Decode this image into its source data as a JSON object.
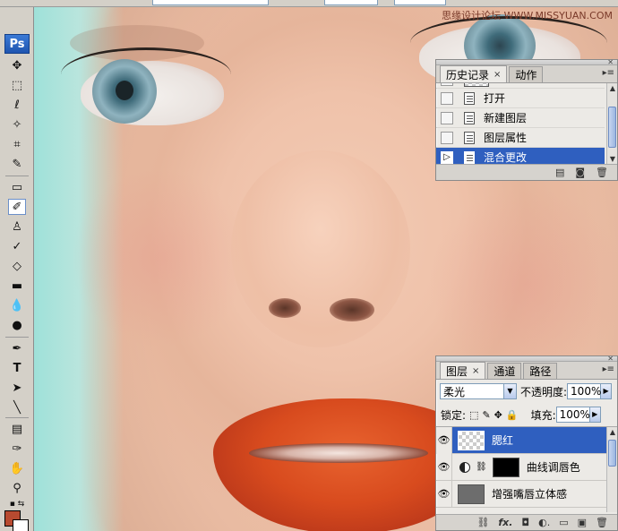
{
  "watermark": "思缘设计论坛  WWW.MISSYUAN.COM",
  "toolbox": {
    "logo": "Ps",
    "colors": {
      "foreground": "#b84a30",
      "background": "#ffffff"
    }
  },
  "history_panel": {
    "tabs": [
      {
        "label": "历史记录",
        "active": true
      },
      {
        "label": "动作",
        "active": false
      }
    ],
    "items": [
      {
        "label": "打开",
        "selected": false
      },
      {
        "label": "新建图层",
        "selected": false
      },
      {
        "label": "图层属性",
        "selected": false
      },
      {
        "label": "混合更改",
        "selected": true
      }
    ]
  },
  "layers_panel": {
    "tabs": [
      {
        "label": "图层",
        "active": true
      },
      {
        "label": "通道",
        "active": false
      },
      {
        "label": "路径",
        "active": false
      }
    ],
    "blend_mode": "柔光",
    "opacity_label": "不透明度:",
    "opacity_value": "100%",
    "lock_label": "锁定:",
    "fill_label": "填充:",
    "fill_value": "100%",
    "layers": [
      {
        "name": "腮红",
        "selected": true
      },
      {
        "name": "曲线调唇色",
        "selected": false
      },
      {
        "name": "增强嘴唇立体感",
        "selected": false
      }
    ]
  }
}
